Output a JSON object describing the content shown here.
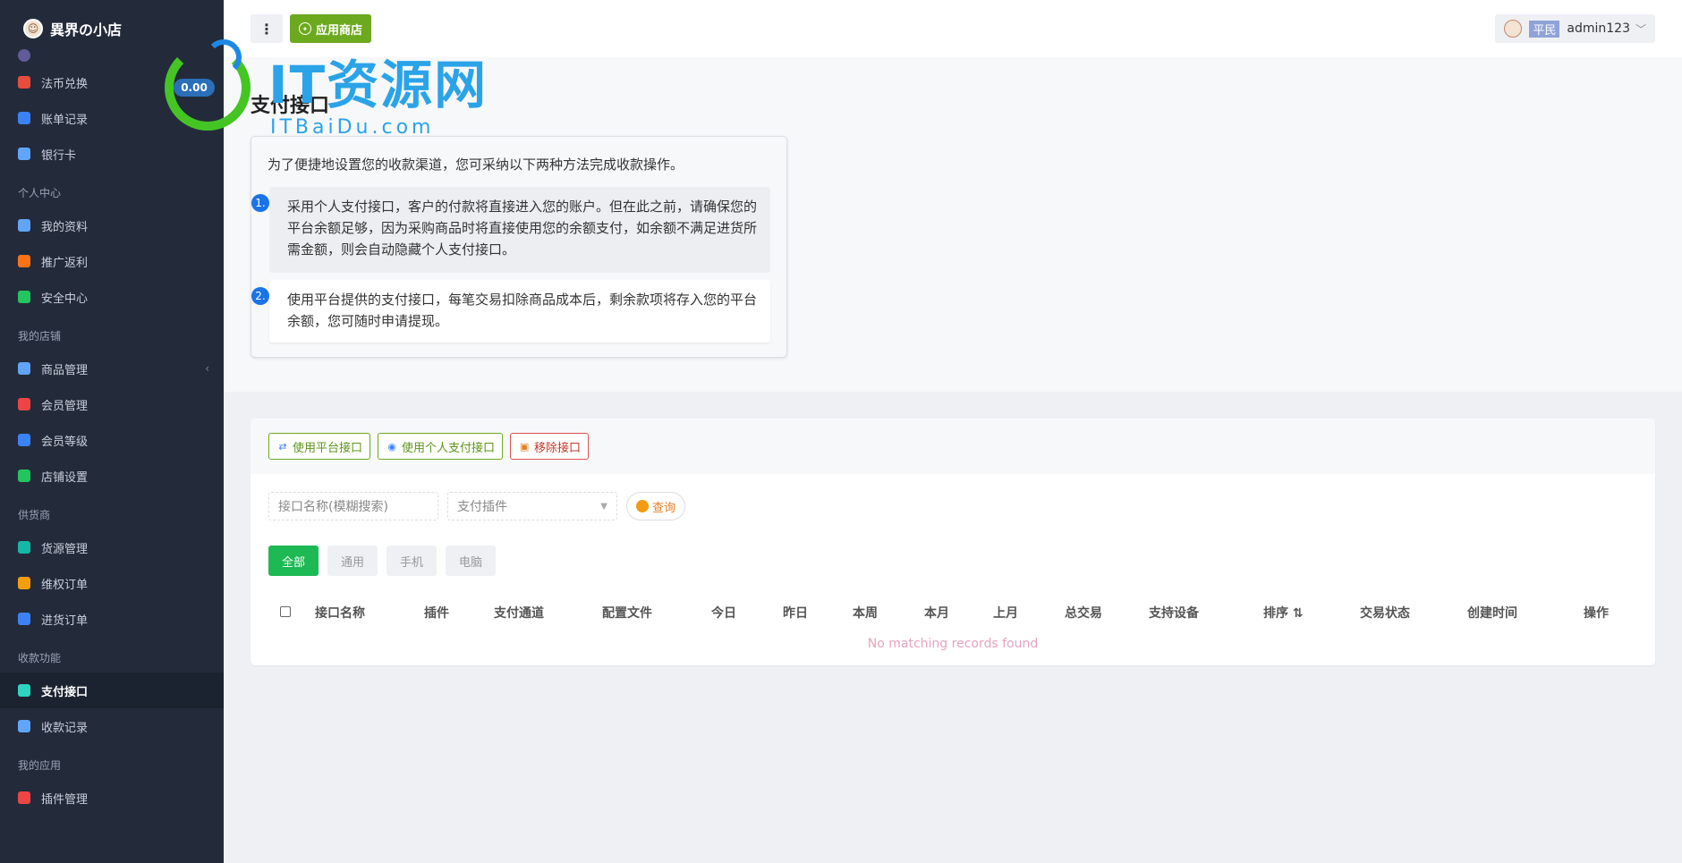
{
  "brand": {
    "title": "異界の小店"
  },
  "sidebar": {
    "items": [
      {
        "type": "item",
        "label": "法币兑换",
        "icon": "exchange-icon",
        "color": "#e74c3c"
      },
      {
        "type": "item",
        "label": "账单记录",
        "icon": "bill-icon",
        "color": "#3b82f6"
      },
      {
        "type": "item",
        "label": "银行卡",
        "icon": "bank-card-icon",
        "color": "#60a5fa"
      },
      {
        "type": "group",
        "label": "个人中心"
      },
      {
        "type": "item",
        "label": "我的资料",
        "icon": "user-icon",
        "color": "#60a5fa"
      },
      {
        "type": "item",
        "label": "推广返利",
        "icon": "paper-plane-icon",
        "color": "#f97316"
      },
      {
        "type": "item",
        "label": "安全中心",
        "icon": "shield-icon",
        "color": "#22c55e"
      },
      {
        "type": "group",
        "label": "我的店铺"
      },
      {
        "type": "item",
        "label": "商品管理",
        "icon": "goods-icon",
        "color": "#60a5fa",
        "expandable": true
      },
      {
        "type": "item",
        "label": "会员管理",
        "icon": "member-icon",
        "color": "#ef4444"
      },
      {
        "type": "item",
        "label": "会员等级",
        "icon": "diamond-icon",
        "color": "#3b82f6"
      },
      {
        "type": "item",
        "label": "店铺设置",
        "icon": "store-settings-icon",
        "color": "#22c55e"
      },
      {
        "type": "group",
        "label": "供货商"
      },
      {
        "type": "item",
        "label": "货源管理",
        "icon": "supply-icon",
        "color": "#14b8a6"
      },
      {
        "type": "item",
        "label": "维权订单",
        "icon": "alert-icon",
        "color": "#f59e0b"
      },
      {
        "type": "item",
        "label": "进货订单",
        "icon": "clipboard-icon",
        "color": "#3b82f6"
      },
      {
        "type": "group",
        "label": "收款功能"
      },
      {
        "type": "item",
        "label": "支付接口",
        "icon": "payment-icon",
        "color": "#2dd4bf",
        "active": true
      },
      {
        "type": "item",
        "label": "收款记录",
        "icon": "receipt-icon",
        "color": "#60a5fa"
      },
      {
        "type": "group",
        "label": "我的应用"
      },
      {
        "type": "item",
        "label": "插件管理",
        "icon": "puzzle-icon",
        "color": "#ef4444"
      }
    ]
  },
  "topbar": {
    "more_icon": "⋮",
    "store_label": "应用商店",
    "user_badge": "平民",
    "username": "admin123"
  },
  "watermark": {
    "balance": "0.00",
    "big": "IT资源网",
    "small": "ITBaiDu.com"
  },
  "page": {
    "title": "支付接口",
    "intro": "为了便捷地设置您的收款渠道，您可采纳以下两种方法完成收款操作。",
    "steps": [
      {
        "num": "1.",
        "text": "采用个人支付接口，客户的付款将直接进入您的账户。但在此之前，请确保您的平台余额足够，因为采购商品时将直接使用您的余额支付，如余额不满足进货所需金额，则会自动隐藏个人支付接口。"
      },
      {
        "num": "2.",
        "text": "使用平台提供的支付接口，每笔交易扣除商品成本后，剩余款项将存入您的平台余额，您可随时申请提现。"
      }
    ]
  },
  "toolbar": {
    "platform_btn": "使用平台接口",
    "personal_btn": "使用个人支付接口",
    "remove_btn": "移除接口"
  },
  "search": {
    "name_placeholder": "接口名称(模糊搜索)",
    "plugin_placeholder": "支付插件",
    "query_btn": "查询"
  },
  "tabs": [
    "全部",
    "通用",
    "手机",
    "电脑"
  ],
  "table": {
    "columns": [
      "接口名称",
      "插件",
      "支付通道",
      "配置文件",
      "今日",
      "昨日",
      "本周",
      "本月",
      "上月",
      "总交易",
      "支持设备",
      "排序 ⇅",
      "交易状态",
      "创建时间",
      "操作"
    ],
    "empty_text": "No matching records found"
  }
}
